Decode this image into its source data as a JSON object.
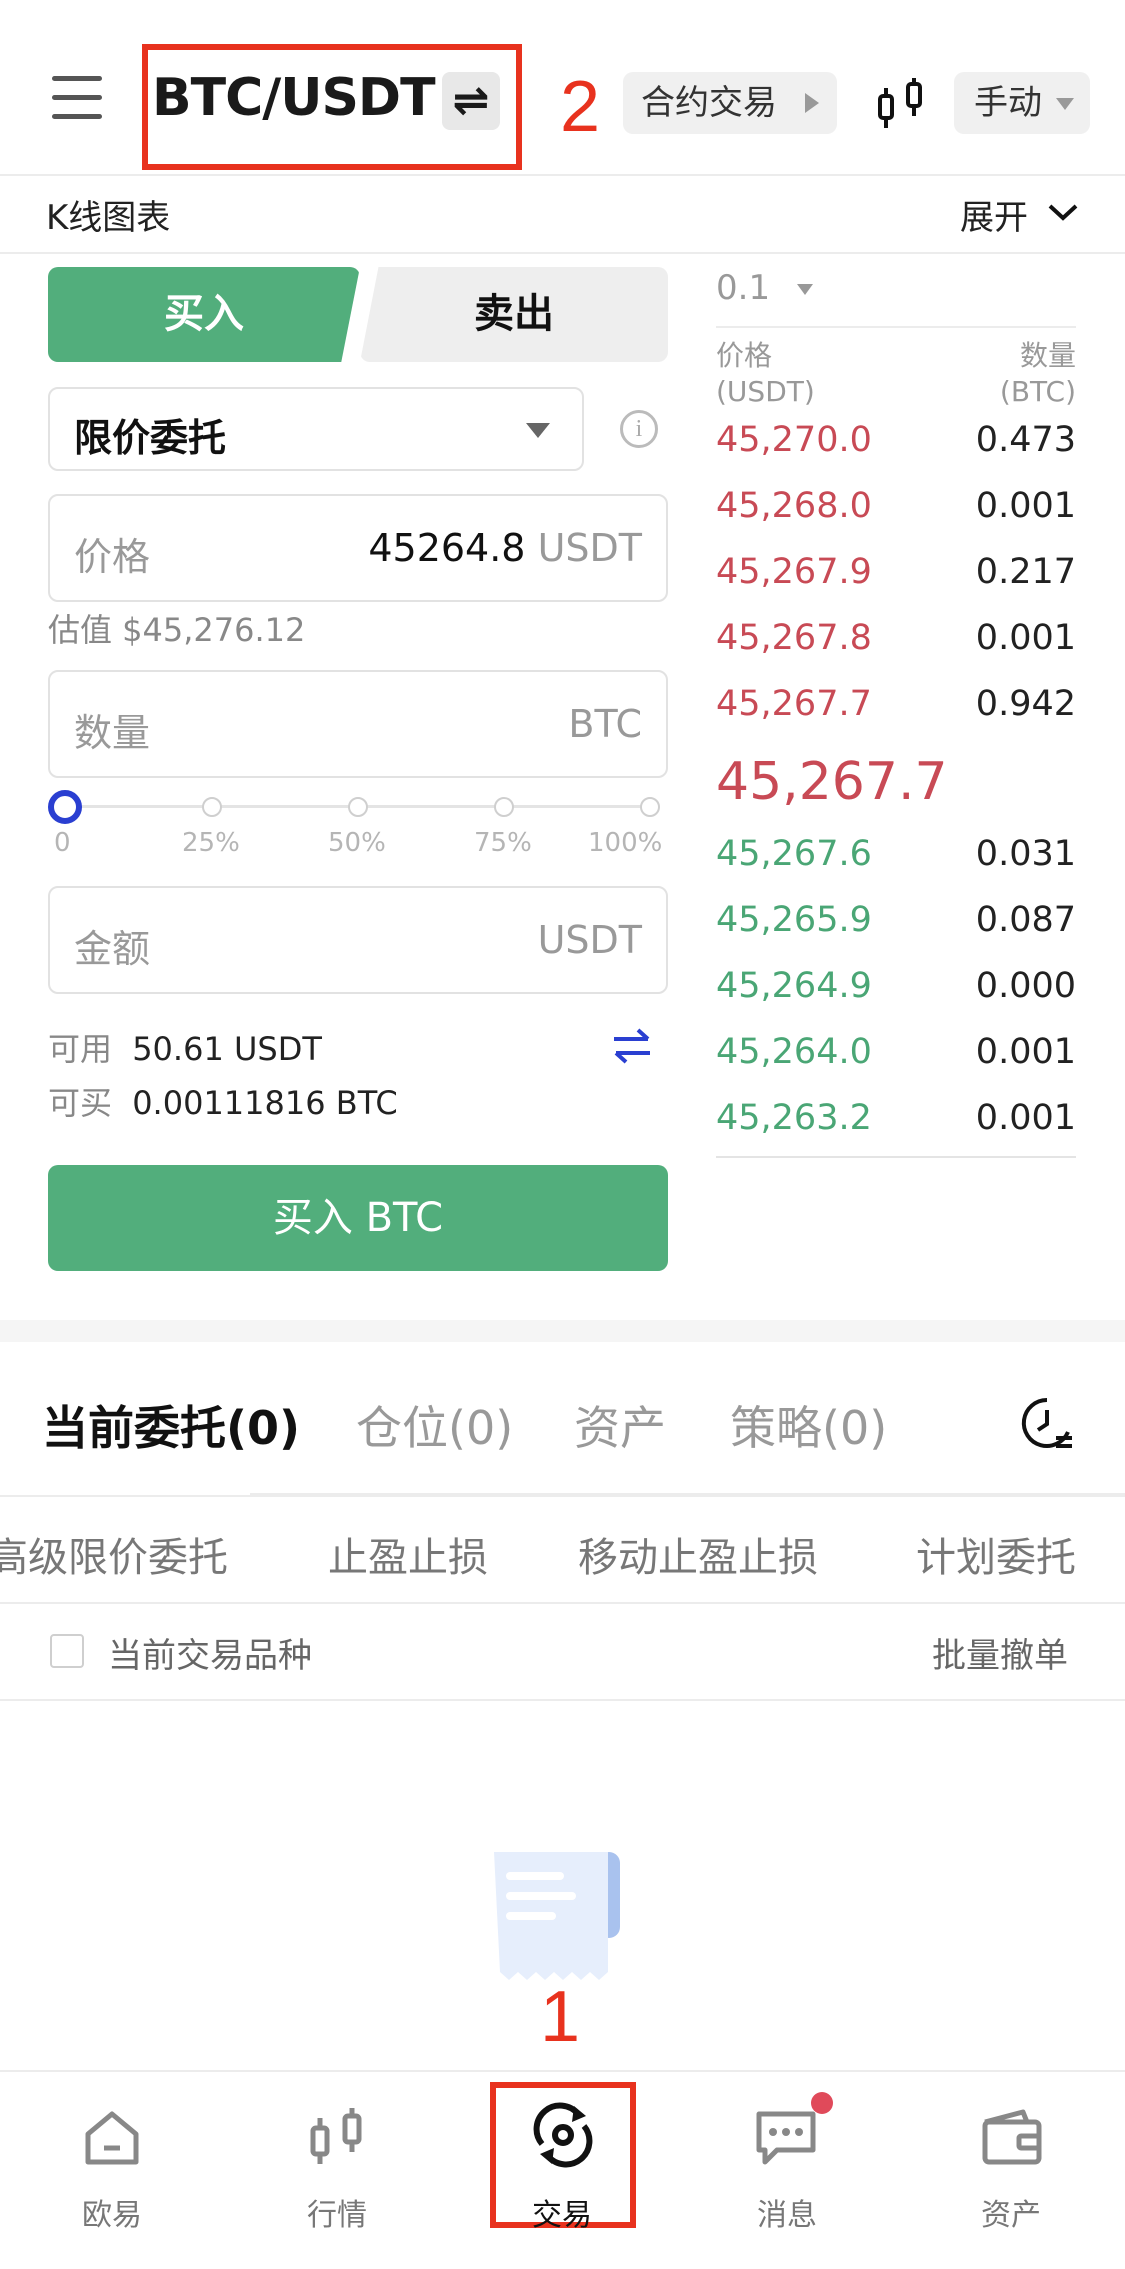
{
  "header": {
    "pair": "BTC/USDT",
    "swap_glyph": "⇌",
    "contract_label": "合约交易",
    "mode_label": "手动",
    "annotation_2": "2"
  },
  "kline": {
    "label": "K线图表",
    "expand_label": "展开"
  },
  "trade": {
    "buy_tab": "买入",
    "sell_tab": "卖出",
    "order_type": "限价委托",
    "price_label": "价格",
    "price_value": "45264.8",
    "price_unit": "USDT",
    "estimate": "估值 $45,276.12",
    "qty_placeholder": "数量",
    "qty_unit": "BTC",
    "slider": {
      "labels": [
        "0",
        "25%",
        "50%",
        "75%",
        "100%"
      ],
      "value_fraction": 0
    },
    "amount_placeholder": "金额",
    "amount_unit": "USDT",
    "available_label": "可用",
    "available_value": "50.61 USDT",
    "buyable_label": "可买",
    "buyable_value": "0.00111816 BTC",
    "buy_button": "买入 BTC"
  },
  "orderbook": {
    "depth": "0.1",
    "price_header": "价格",
    "price_unit": "(USDT)",
    "qty_header": "数量",
    "qty_unit": "(BTC)",
    "asks": [
      {
        "price": "45,270.0",
        "qty": "0.473"
      },
      {
        "price": "45,268.0",
        "qty": "0.001"
      },
      {
        "price": "45,267.9",
        "qty": "0.217"
      },
      {
        "price": "45,267.8",
        "qty": "0.001"
      },
      {
        "price": "45,267.7",
        "qty": "0.942"
      }
    ],
    "last_price": "45,267.7",
    "bids": [
      {
        "price": "45,267.6",
        "qty": "0.031"
      },
      {
        "price": "45,265.9",
        "qty": "0.087"
      },
      {
        "price": "45,264.9",
        "qty": "0.000"
      },
      {
        "price": "45,264.0",
        "qty": "0.001"
      },
      {
        "price": "45,263.2",
        "qty": "0.001"
      }
    ],
    "colors": {
      "ask": "#c84a55",
      "bid": "#4aa675"
    }
  },
  "orders": {
    "tabs": [
      "当前委托(0)",
      "仓位(0)",
      "资产",
      "策略(0)"
    ],
    "subtabs": [
      "高级限价委托",
      "止盈止损",
      "移动止盈止损",
      "计划委托"
    ],
    "filter_label": "当前交易品种",
    "batch_cancel": "批量撤单"
  },
  "annotation_1": "1",
  "nav": [
    {
      "label": "欧易",
      "icon": "home-icon"
    },
    {
      "label": "行情",
      "icon": "candlestick-icon"
    },
    {
      "label": "交易",
      "icon": "trade-icon"
    },
    {
      "label": "消息",
      "icon": "message-icon"
    },
    {
      "label": "资产",
      "icon": "wallet-icon"
    }
  ],
  "accent": {
    "green": "#52ae7c",
    "red": "#e8321e",
    "blue": "#2a3fd1"
  }
}
